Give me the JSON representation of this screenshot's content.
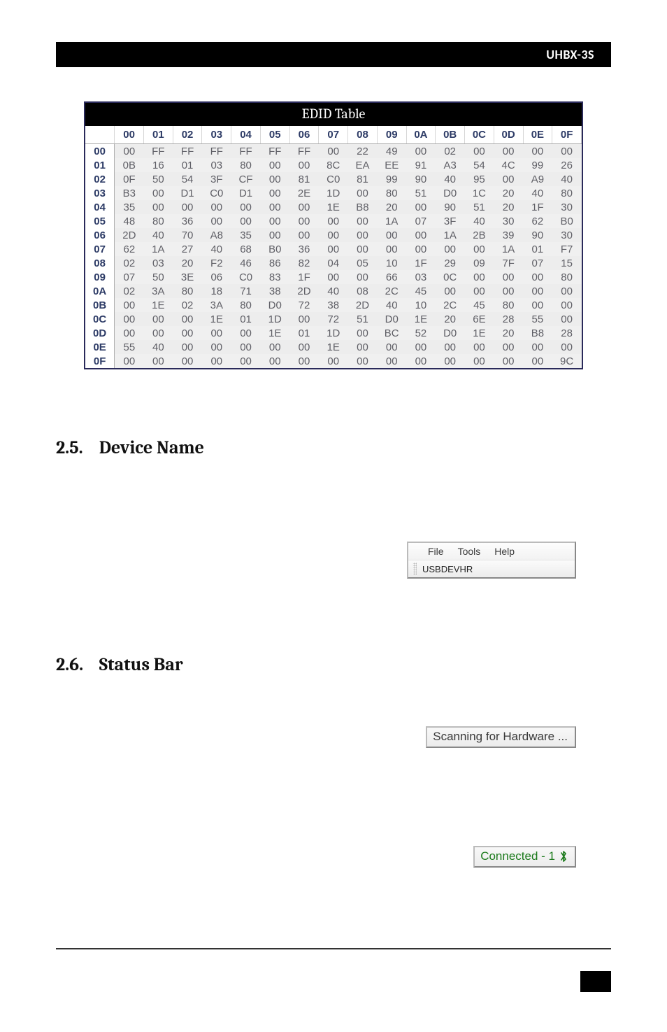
{
  "header": {
    "product": "UHBX-3S"
  },
  "edid": {
    "title": "EDID Table",
    "cols": [
      "00",
      "01",
      "02",
      "03",
      "04",
      "05",
      "06",
      "07",
      "08",
      "09",
      "0A",
      "0B",
      "0C",
      "0D",
      "0E",
      "0F"
    ],
    "row_labels": [
      "00",
      "01",
      "02",
      "03",
      "04",
      "05",
      "06",
      "07",
      "08",
      "09",
      "0A",
      "0B",
      "0C",
      "0D",
      "0E",
      "0F"
    ],
    "rows": [
      [
        "00",
        "FF",
        "FF",
        "FF",
        "FF",
        "FF",
        "FF",
        "00",
        "22",
        "49",
        "00",
        "02",
        "00",
        "00",
        "00",
        "00"
      ],
      [
        "0B",
        "16",
        "01",
        "03",
        "80",
        "00",
        "00",
        "8C",
        "EA",
        "EE",
        "91",
        "A3",
        "54",
        "4C",
        "99",
        "26"
      ],
      [
        "0F",
        "50",
        "54",
        "3F",
        "CF",
        "00",
        "81",
        "C0",
        "81",
        "99",
        "90",
        "40",
        "95",
        "00",
        "A9",
        "40"
      ],
      [
        "B3",
        "00",
        "D1",
        "C0",
        "D1",
        "00",
        "2E",
        "1D",
        "00",
        "80",
        "51",
        "D0",
        "1C",
        "20",
        "40",
        "80"
      ],
      [
        "35",
        "00",
        "00",
        "00",
        "00",
        "00",
        "00",
        "1E",
        "B8",
        "20",
        "00",
        "90",
        "51",
        "20",
        "1F",
        "30"
      ],
      [
        "48",
        "80",
        "36",
        "00",
        "00",
        "00",
        "00",
        "00",
        "00",
        "1A",
        "07",
        "3F",
        "40",
        "30",
        "62",
        "B0"
      ],
      [
        "2D",
        "40",
        "70",
        "A8",
        "35",
        "00",
        "00",
        "00",
        "00",
        "00",
        "00",
        "1A",
        "2B",
        "39",
        "90",
        "30"
      ],
      [
        "62",
        "1A",
        "27",
        "40",
        "68",
        "B0",
        "36",
        "00",
        "00",
        "00",
        "00",
        "00",
        "00",
        "1A",
        "01",
        "F7"
      ],
      [
        "02",
        "03",
        "20",
        "F2",
        "46",
        "86",
        "82",
        "04",
        "05",
        "10",
        "1F",
        "29",
        "09",
        "7F",
        "07",
        "15"
      ],
      [
        "07",
        "50",
        "3E",
        "06",
        "C0",
        "83",
        "1F",
        "00",
        "00",
        "66",
        "03",
        "0C",
        "00",
        "00",
        "00",
        "80"
      ],
      [
        "02",
        "3A",
        "80",
        "18",
        "71",
        "38",
        "2D",
        "40",
        "08",
        "2C",
        "45",
        "00",
        "00",
        "00",
        "00",
        "00"
      ],
      [
        "00",
        "1E",
        "02",
        "3A",
        "80",
        "D0",
        "72",
        "38",
        "2D",
        "40",
        "10",
        "2C",
        "45",
        "80",
        "00",
        "00"
      ],
      [
        "00",
        "00",
        "00",
        "1E",
        "01",
        "1D",
        "00",
        "72",
        "51",
        "D0",
        "1E",
        "20",
        "6E",
        "28",
        "55",
        "00"
      ],
      [
        "00",
        "00",
        "00",
        "00",
        "00",
        "1E",
        "01",
        "1D",
        "00",
        "BC",
        "52",
        "D0",
        "1E",
        "20",
        "B8",
        "28"
      ],
      [
        "55",
        "40",
        "00",
        "00",
        "00",
        "00",
        "00",
        "1E",
        "00",
        "00",
        "00",
        "00",
        "00",
        "00",
        "00",
        "00"
      ],
      [
        "00",
        "00",
        "00",
        "00",
        "00",
        "00",
        "00",
        "00",
        "00",
        "00",
        "00",
        "00",
        "00",
        "00",
        "00",
        "9C"
      ]
    ]
  },
  "sections": {
    "s25": {
      "num": "2.5.",
      "title": "Device Name"
    },
    "s26": {
      "num": "2.6.",
      "title": "Status Bar"
    }
  },
  "menu": {
    "file": "File",
    "tools": "Tools",
    "help": "Help",
    "device": "USBDEVHR"
  },
  "status": {
    "scanning": "Scanning for Hardware ...",
    "connected": "Connected - 1"
  }
}
